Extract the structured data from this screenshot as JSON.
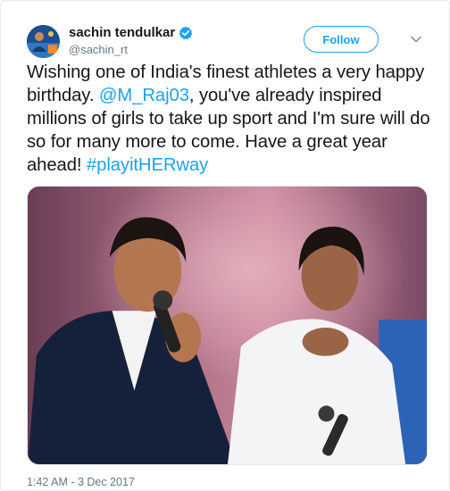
{
  "user": {
    "display_name": "sachin tendulkar",
    "handle": "@sachin_rt",
    "verified": true
  },
  "actions": {
    "follow_label": "Follow",
    "more_icon": "chevron-down-icon"
  },
  "tweet": {
    "part1": "Wishing one of India's finest athletes a very happy birthday. ",
    "mention": "@M_Raj03",
    "part2": ", you've already inspired millions of girls to take up sport and I'm sure will do so for many more to come. Have a great year ahead! ",
    "hashtag": "#playitHERway"
  },
  "media": {
    "type": "photo"
  },
  "timestamp": "1:42 AM - 3 Dec 2017",
  "colors": {
    "link": "#1da1f2",
    "text": "#14171a",
    "secondary": "#657786",
    "verified": "#1da1f2"
  }
}
